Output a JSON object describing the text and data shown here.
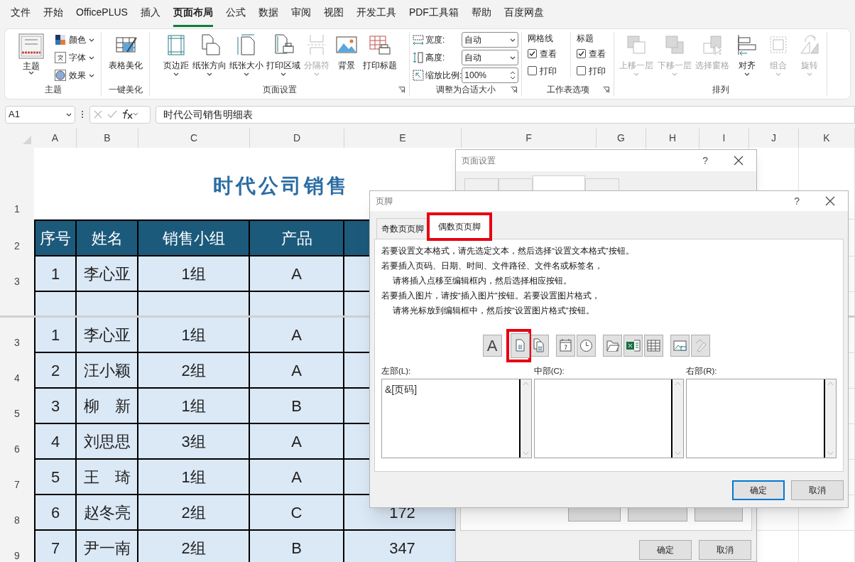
{
  "menu_tabs": [
    {
      "label": "文件",
      "selected": false
    },
    {
      "label": "开始",
      "selected": false
    },
    {
      "label": "OfficePLUS",
      "selected": false
    },
    {
      "label": "插入",
      "selected": false
    },
    {
      "label": "页面布局",
      "selected": true
    },
    {
      "label": "公式",
      "selected": false
    },
    {
      "label": "数据",
      "selected": false
    },
    {
      "label": "审阅",
      "selected": false
    },
    {
      "label": "视图",
      "selected": false
    },
    {
      "label": "开发工具",
      "selected": false
    },
    {
      "label": "PDF工具箱",
      "selected": false
    },
    {
      "label": "帮助",
      "selected": false
    },
    {
      "label": "百度网盘",
      "selected": false
    }
  ],
  "ribbon": {
    "groups": [
      {
        "kind": "theme",
        "label": "主题",
        "launcher": false,
        "big": {
          "label": "主题"
        },
        "small": [
          {
            "label": "颜色"
          },
          {
            "label": "字体"
          },
          {
            "label": "效果"
          }
        ]
      },
      {
        "kind": "buttons",
        "label": "一键美化",
        "launcher": false,
        "buttons": [
          {
            "label": "表格美化",
            "disabled": false,
            "dropdown": false
          }
        ]
      },
      {
        "kind": "buttons",
        "label": "页面设置",
        "launcher": true,
        "buttons": [
          {
            "label": "页边距",
            "disabled": false,
            "dropdown": true
          },
          {
            "label": "纸张方向",
            "disabled": false,
            "dropdown": true
          },
          {
            "label": "纸张大小",
            "disabled": false,
            "dropdown": true
          },
          {
            "label": "打印区域",
            "disabled": false,
            "dropdown": true
          },
          {
            "label": "分隔符",
            "disabled": true,
            "dropdown": true
          },
          {
            "label": "背景",
            "disabled": false,
            "dropdown": false
          },
          {
            "label": "打印标题",
            "disabled": false,
            "dropdown": false
          }
        ]
      },
      {
        "kind": "scale",
        "label": "调整为合适大小",
        "launcher": true,
        "fields": [
          {
            "kind": "select",
            "label": "宽度:",
            "value": "自动"
          },
          {
            "kind": "select",
            "label": "高度:",
            "value": "自动"
          },
          {
            "kind": "spinner",
            "label": "缩放比例:",
            "value": "100%"
          }
        ]
      },
      {
        "kind": "sheet_options",
        "label": "工作表选项",
        "launcher": true,
        "columns": [
          {
            "title": "网格线",
            "options": [
              {
                "label": "查看",
                "checked": true
              },
              {
                "label": "打印",
                "checked": false
              }
            ]
          },
          {
            "title": "标题",
            "options": [
              {
                "label": "查看",
                "checked": true
              },
              {
                "label": "打印",
                "checked": false
              }
            ]
          }
        ]
      },
      {
        "kind": "buttons",
        "label": "排列",
        "launcher": false,
        "buttons": [
          {
            "label": "上移一层",
            "disabled": true,
            "dropdown": true
          },
          {
            "label": "下移一层",
            "disabled": true,
            "dropdown": true
          },
          {
            "label": "选择窗格",
            "disabled": true,
            "dropdown": false
          },
          {
            "label": "对齐",
            "disabled": false,
            "dropdown": true
          },
          {
            "label": "组合",
            "disabled": true,
            "dropdown": true
          },
          {
            "label": "旋转",
            "disabled": true,
            "dropdown": true
          }
        ]
      }
    ]
  },
  "formula_bar": {
    "name_box": "A1",
    "formula": "时代公司销售明细表"
  },
  "sheet": {
    "columns": [
      "A",
      "B",
      "C",
      "D",
      "E",
      "F",
      "G",
      "H",
      "I",
      "J",
      "K"
    ],
    "title_row": "1",
    "title": "时代公司销售",
    "header_row": "2",
    "header": [
      "序号",
      "姓名",
      "销售小组",
      "产品"
    ],
    "top_rows": [
      {
        "row": "3",
        "cells": [
          "1",
          "李心亚",
          "1组",
          "A"
        ]
      }
    ],
    "bottom_rows": [
      {
        "row": "3",
        "cells": [
          "1",
          "李心亚",
          "1组",
          "A"
        ]
      },
      {
        "row": "4",
        "cells": [
          "2",
          "汪小颖",
          "2组",
          "A"
        ]
      },
      {
        "row": "5",
        "cells": [
          "3",
          "柳　新",
          "1组",
          "B"
        ]
      },
      {
        "row": "6",
        "cells": [
          "4",
          "刘思思",
          "3组",
          "A"
        ]
      },
      {
        "row": "7",
        "cells": [
          "5",
          "王　琦",
          "1组",
          "A"
        ]
      },
      {
        "row": "8",
        "cells": [
          "6",
          "赵冬亮",
          "2组",
          "C",
          "172"
        ]
      },
      {
        "row": "9",
        "cells": [
          "7",
          "尹一南",
          "2组",
          "B",
          "347"
        ]
      }
    ]
  },
  "page_setup_dialog": {
    "title": "页面设置",
    "help": "?",
    "tabs": [
      {
        "selected": false
      },
      {
        "selected": false
      },
      {
        "selected": true
      },
      {
        "selected": false
      }
    ],
    "buttons": [
      {
        "label": "确定"
      },
      {
        "label": "取消"
      }
    ]
  },
  "footer_dialog": {
    "title": "页脚",
    "help": "?",
    "tabs": [
      {
        "label": "奇数页页脚",
        "selected": false,
        "highlighted": false
      },
      {
        "label": "偶数页页脚",
        "selected": true,
        "highlighted": true
      }
    ],
    "instructions": [
      {
        "text": "若要设置文本格式，请先选定文本，然后选择“设置文本格式”按钮。",
        "kind": "line"
      },
      {
        "text": "若要插入页码、日期、时间、文件路径、文件名或标签名，",
        "kind": "line"
      },
      {
        "text": "请将插入点移至编辑框内，然后选择相应按钮。",
        "kind": "continuation"
      },
      {
        "text": "若要插入图片，请按“插入图片”按钮。若要设置图片格式，",
        "kind": "line"
      },
      {
        "text": "请将光标放到编辑框中，然后按“设置图片格式”按钮。",
        "kind": "continuation"
      }
    ],
    "toolbar": [
      [
        {
          "glyph": "A",
          "highlighted": false
        }
      ],
      [
        {
          "highlighted": true
        },
        {
          "highlighted": false
        }
      ],
      [
        {
          "highlighted": false
        },
        {
          "highlighted": false
        }
      ],
      [
        {
          "highlighted": false
        },
        {
          "highlighted": false
        },
        {
          "highlighted": false
        }
      ],
      [
        {
          "highlighted": false
        },
        {
          "highlighted": false
        }
      ]
    ],
    "sections": [
      {
        "label": "左部(L):",
        "value": "&[页码]"
      },
      {
        "label": "中部(C):"
      },
      {
        "label": "右部(R):"
      }
    ],
    "buttons": [
      {
        "label": "确定",
        "default": true
      },
      {
        "label": "取消",
        "default": false
      }
    ]
  }
}
